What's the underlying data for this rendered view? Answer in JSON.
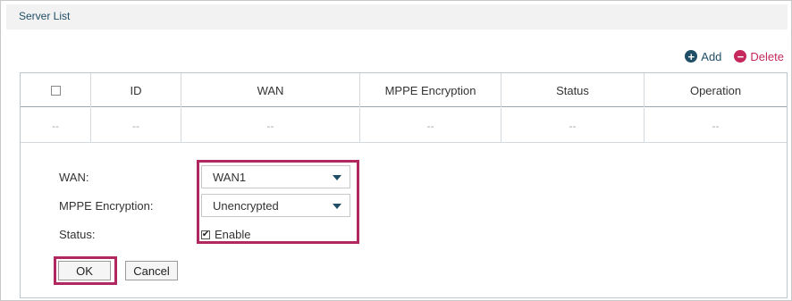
{
  "panel": {
    "title": "Server List"
  },
  "toolbar": {
    "add_label": "Add",
    "delete_label": "Delete"
  },
  "table": {
    "columns": [
      "ID",
      "WAN",
      "MPPE Encryption",
      "Status",
      "Operation"
    ],
    "empty_row": [
      "--",
      "--",
      "--",
      "--",
      "--",
      "--"
    ]
  },
  "form": {
    "wan_label": "WAN:",
    "wan_value": "WAN1",
    "mppe_label": "MPPE Encryption:",
    "mppe_value": "Unencrypted",
    "status_label": "Status:",
    "enable_label": "Enable",
    "enable_checked": true,
    "ok_label": "OK",
    "cancel_label": "Cancel"
  },
  "colors": {
    "accent": "#1f4e66",
    "delete": "#c6285e",
    "highlight": "#b0285f"
  }
}
